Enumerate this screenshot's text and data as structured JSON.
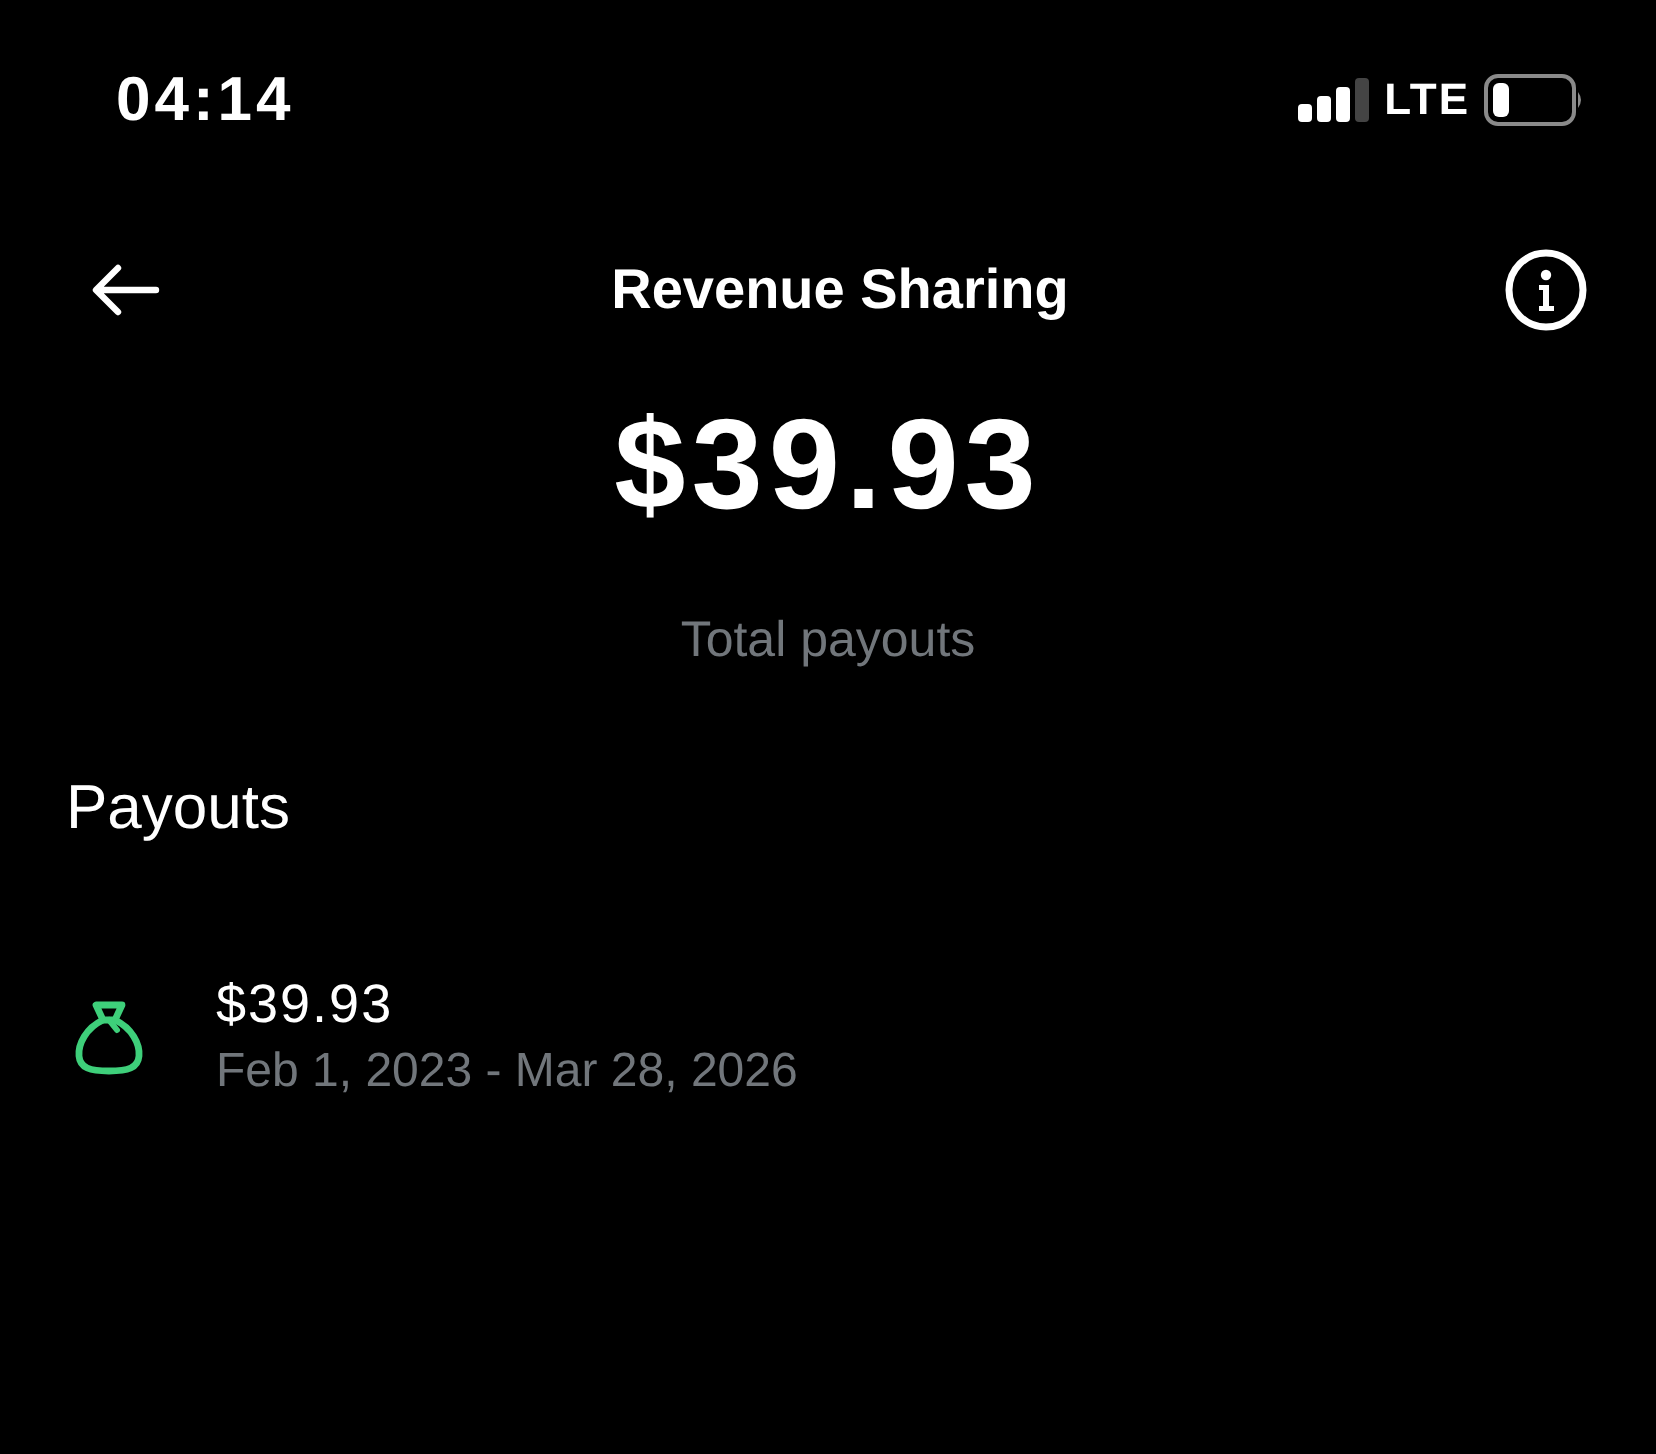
{
  "status_bar": {
    "time": "04:14",
    "network": "LTE"
  },
  "header": {
    "title": "Revenue Sharing"
  },
  "summary": {
    "amount": "$39.93",
    "label": "Total payouts"
  },
  "payouts": {
    "heading": "Payouts",
    "items": [
      {
        "amount": "$39.93",
        "period": "Feb 1, 2023 - Mar 28, 2026"
      }
    ]
  }
}
